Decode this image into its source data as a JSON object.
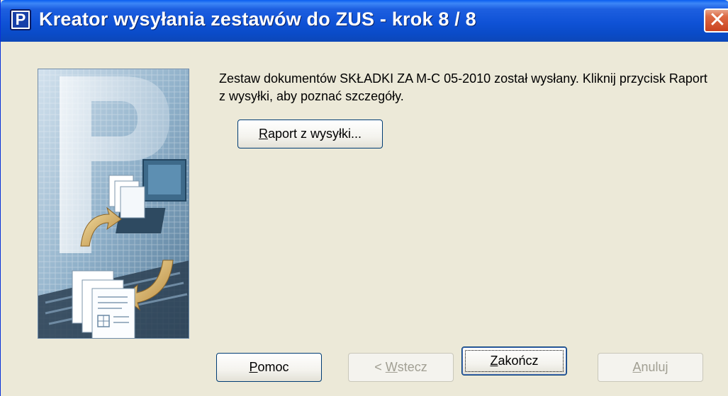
{
  "window": {
    "title": "Kreator wysyłania zestawów do ZUS - krok 8 / 8",
    "app_icon_letter": "P",
    "close_glyph": "✕"
  },
  "message": {
    "text": "Zestaw dokumentów SKŁADKI ZA M-C 05-2010 został wysłany. Kliknij przycisk Raport z wysyłki, aby poznać szczegóły."
  },
  "buttons": {
    "raport": {
      "mnemonic": "R",
      "rest": "aport z wysyłki...",
      "enabled": true
    },
    "help": {
      "mnemonic": "P",
      "rest": "omoc",
      "enabled": true
    },
    "back": {
      "prefix": "< ",
      "mnemonic": "W",
      "rest": "stecz",
      "enabled": false
    },
    "finish": {
      "mnemonic": "Z",
      "rest": "akończ",
      "enabled": true,
      "default": true
    },
    "cancel": {
      "mnemonic": "A",
      "rest": "nuluj",
      "enabled": false
    }
  },
  "illustration": {
    "icon": "wizard-documents-computer-icon"
  },
  "colors": {
    "titlebar": "#0f52d6",
    "window_bg": "#ece9d8",
    "close_button": "#c9421f"
  }
}
